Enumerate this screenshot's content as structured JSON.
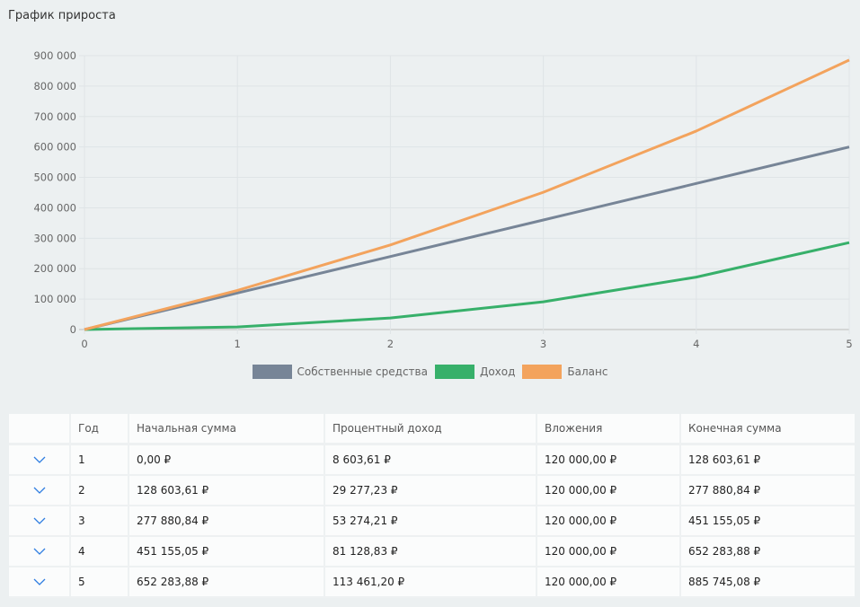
{
  "title": "График прироста",
  "chart_data": {
    "type": "line",
    "x": [
      0,
      1,
      2,
      3,
      4,
      5
    ],
    "xticks": [
      "0",
      "1",
      "2",
      "3",
      "4",
      "5"
    ],
    "yticks": [
      "0",
      "100 000",
      "200 000",
      "300 000",
      "400 000",
      "500 000",
      "600 000",
      "700 000",
      "800 000",
      "900 000"
    ],
    "ylim": [
      0,
      900000
    ],
    "grid": true,
    "legend_position": "bottom",
    "series": [
      {
        "name": "Собственные средства",
        "color": "#778597",
        "values": [
          0,
          120000,
          240000,
          360000,
          480000,
          600000
        ]
      },
      {
        "name": "Доход",
        "color": "#37b06a",
        "values": [
          0,
          8603.61,
          37880.84,
          91155.05,
          172283.88,
          285745.08
        ]
      },
      {
        "name": "Баланс",
        "color": "#f3a35d",
        "values": [
          0,
          128603.61,
          277880.84,
          451155.05,
          652283.88,
          885745.08
        ]
      }
    ]
  },
  "table": {
    "headers": [
      "",
      "Год",
      "Начальная сумма",
      "Процентный доход",
      "Вложения",
      "Конечная сумма"
    ],
    "rows": [
      [
        "1",
        "0,00 ₽",
        "8 603,61 ₽",
        "120 000,00 ₽",
        "128 603,61 ₽"
      ],
      [
        "2",
        "128 603,61 ₽",
        "29 277,23 ₽",
        "120 000,00 ₽",
        "277 880,84 ₽"
      ],
      [
        "3",
        "277 880,84 ₽",
        "53 274,21 ₽",
        "120 000,00 ₽",
        "451 155,05 ₽"
      ],
      [
        "4",
        "451 155,05 ₽",
        "81 128,83 ₽",
        "120 000,00 ₽",
        "652 283,88 ₽"
      ],
      [
        "5",
        "652 283,88 ₽",
        "113 461,20 ₽",
        "120 000,00 ₽",
        "885 745,08 ₽"
      ]
    ]
  }
}
